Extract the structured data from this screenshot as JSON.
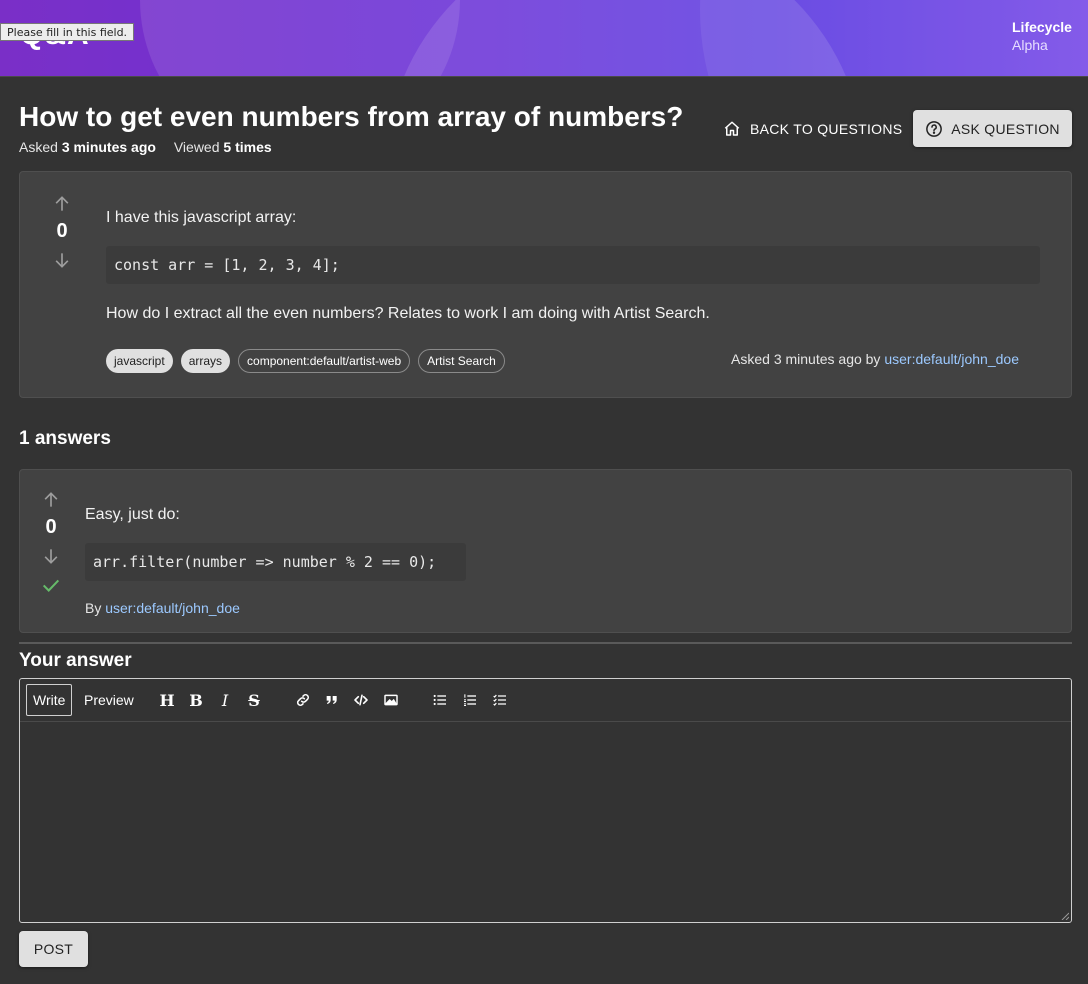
{
  "banner": {
    "title": "Q&A",
    "tooltip": "Please fill in this field.",
    "lifecycle_label": "Lifecycle",
    "lifecycle_value": "Alpha"
  },
  "question": {
    "title": "How to get even numbers from array of numbers?",
    "asked_label": "Asked",
    "asked_value": "3 minutes ago",
    "viewed_label": "Viewed",
    "viewed_value": "5 times",
    "score": "0",
    "body_intro": "I have this javascript array:",
    "code": "const arr = [1, 2, 3, 4];",
    "body_outro": "How do I extract all the even numbers? Relates to work I am doing with Artist Search.",
    "tags": [
      {
        "label": "javascript",
        "style": "filled"
      },
      {
        "label": "arrays",
        "style": "filled"
      },
      {
        "label": "component:default/artist-web",
        "style": "outlined"
      },
      {
        "label": "Artist Search",
        "style": "outlined"
      }
    ],
    "asked_by_prefix": "Asked 3 minutes ago by",
    "asked_by_user": "user:default/john_doe"
  },
  "actions": {
    "back_label": "BACK TO QUESTIONS",
    "ask_label": "ASK QUESTION"
  },
  "answers": {
    "count_label": "1 answers",
    "items": [
      {
        "score": "0",
        "text": "Easy, just do:",
        "code": "arr.filter(number => number % 2 == 0);",
        "by_prefix": "By",
        "by_user": "user:default/john_doe",
        "accepted": true
      }
    ]
  },
  "editor": {
    "heading": "Your answer",
    "tab_write": "Write",
    "tab_preview": "Preview",
    "tools": [
      "heading-icon",
      "bold-icon",
      "italic-icon",
      "strikethrough-icon",
      "link-icon",
      "quote-icon",
      "code-icon",
      "image-icon",
      "bullet-list-icon",
      "numbered-list-icon",
      "checklist-icon"
    ],
    "value": "",
    "post_label": "POST"
  },
  "colors": {
    "background": "#333333",
    "card": "#424242",
    "banner_start": "#7a2fc7",
    "banner_end": "#7b4fe8",
    "link": "#9cc9ff",
    "accepted": "#66bb6a"
  }
}
